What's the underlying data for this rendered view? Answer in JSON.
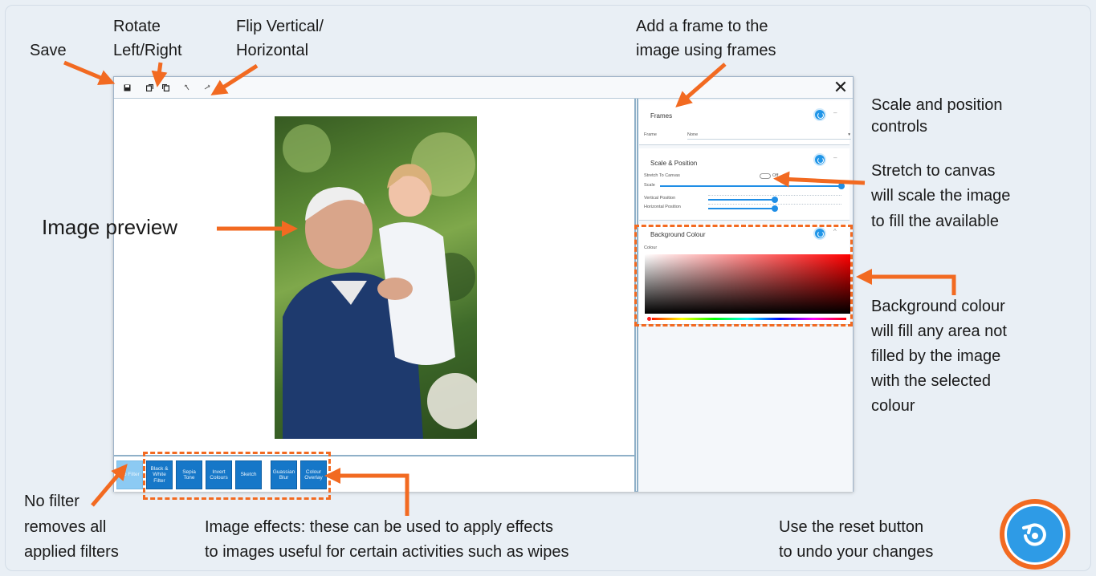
{
  "annotations": {
    "save": "Save",
    "rotate_line1": "Rotate",
    "rotate_line2": "Left/Right",
    "flip_line1": "Flip Vertical/",
    "flip_line2": "Horizontal",
    "frame_line1": "Add a frame to the",
    "frame_line2": "image using frames",
    "scale_line1": "Scale and position",
    "scale_line2": "controls",
    "stretch_line1": "Stretch to canvas",
    "stretch_line2": "will scale the image",
    "stretch_line3": "to fill the available",
    "preview": "Image preview",
    "bg_line1": "Background colour",
    "bg_line2": "will fill any area not",
    "bg_line3": "filled by the image",
    "bg_line4": "with the selected",
    "bg_line5": "colour",
    "nofilter_line1": "No filter",
    "nofilter_line2": "removes all",
    "nofilter_line3": "applied filters",
    "effects_line1": "Image effects: these can be used to apply effects",
    "effects_line2": "to images useful for certain activities such as wipes",
    "reset_line1": "Use the reset button",
    "reset_line2": "to undo your changes"
  },
  "window": {
    "close_glyph": "✕",
    "toolbar_icons": [
      "save-icon",
      "rotate-left-icon",
      "rotate-right-icon",
      "flip-vertical-icon",
      "flip-horizontal-icon"
    ]
  },
  "panel": {
    "frames": {
      "title": "Frames",
      "frame_label": "Frame",
      "frame_value": "None"
    },
    "scale": {
      "title": "Scale & Position",
      "stretch_label": "Stretch To Canvas",
      "toggle_text": "Off",
      "scale_label": "Scale",
      "vertical_label": "Vertical Position",
      "horizontal_label": "Horizontal Position",
      "scale_value": 1.0,
      "vertical_value": 0.5,
      "horizontal_value": 0.5
    },
    "background": {
      "title": "Background Colour",
      "colour_label": "Colour",
      "selected_hue": "#ff0000"
    }
  },
  "filters": [
    {
      "label": "No Filter",
      "active": true
    },
    {
      "label": "Black & White Filter",
      "active": false
    },
    {
      "label": "Sepia Tone",
      "active": false
    },
    {
      "label": "Invert Colours",
      "active": false
    },
    {
      "label": "Sketch",
      "active": false
    },
    {
      "label": "Guassian Blur",
      "active": false
    },
    {
      "label": "Colour Overlay",
      "active": false
    }
  ],
  "colors": {
    "accent_orange": "#f26a21",
    "button_blue": "#1677c8",
    "active_filter": "#8ccaf3",
    "reset_blue": "#2e9be6"
  }
}
